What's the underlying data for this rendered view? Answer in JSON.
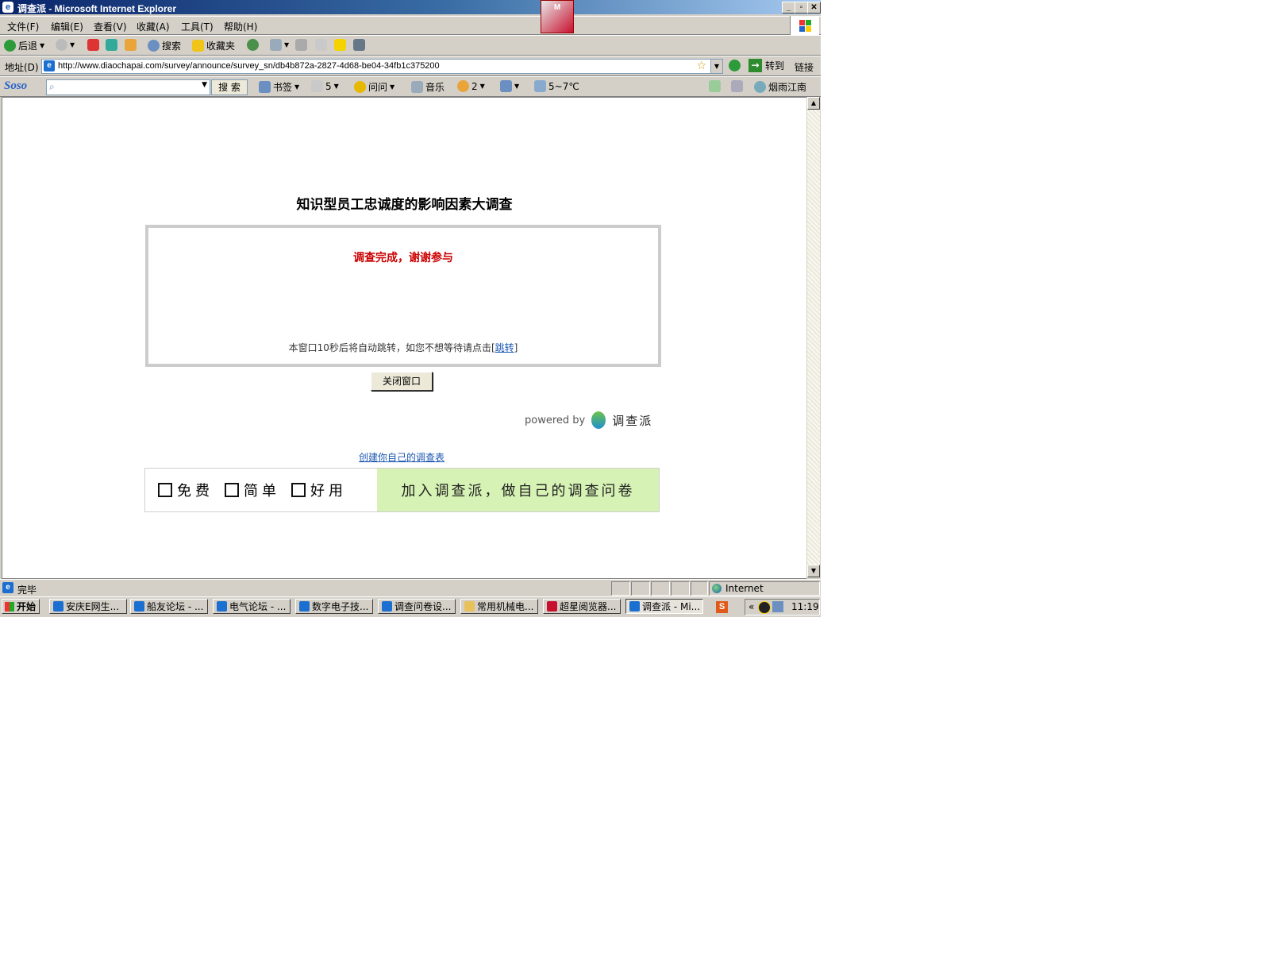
{
  "window": {
    "title": "调查派 - Microsoft Internet Explorer",
    "controls": [
      "_",
      "▫",
      "✕"
    ]
  },
  "menu": [
    "文件(F)",
    "编辑(E)",
    "查看(V)",
    "收藏(A)",
    "工具(T)",
    "帮助(H)"
  ],
  "toolbar": {
    "back": "后退",
    "search": "搜索",
    "favorites": "收藏夹"
  },
  "address": {
    "label": "地址(D)",
    "url": "http://www.diaochapai.com/survey/announce/survey_sn/db4b872a-2827-4d68-be04-34fb1c375200",
    "go": "转到",
    "links": "链接"
  },
  "soso": {
    "logo": "Soso",
    "search_button": "搜 索",
    "bookmarks": "书签",
    "mail_count": "5",
    "ask": "问问",
    "music": "音乐",
    "count2": "2",
    "weather": "5~7℃",
    "location": "烟雨江南"
  },
  "page": {
    "title": "知识型员工忠诚度的影响因素大调查",
    "done_message": "调查完成，谢谢参与",
    "redirect_prefix": "本窗口10秒后将自动跳转，如您不想等待请点击[",
    "redirect_link": "跳转",
    "redirect_suffix": "]",
    "close_button": "关闭窗口",
    "powered_by": "powered by",
    "brand": "调查派",
    "create_link": "创建你自己的调查表",
    "banner_items": [
      "免费",
      "简单",
      "好用"
    ],
    "banner_cta": "加入调查派，做自己的调查问卷"
  },
  "status": {
    "text": "完毕",
    "zone": "Internet"
  },
  "taskbar": {
    "start": "开始",
    "tasks": [
      "安庆E网生...",
      "船友论坛 - ...",
      "电气论坛 - ...",
      "数字电子技...",
      "调查问卷设...",
      "常用机械电...",
      "超星阅览器...",
      "调查派 - Mi..."
    ],
    "clock": "11:19"
  },
  "colors": {
    "title_gradient_start": "#0a246a",
    "done_red": "#cc0000",
    "banner_green": "#d6f2b4",
    "link_blue": "#1a56b0"
  }
}
